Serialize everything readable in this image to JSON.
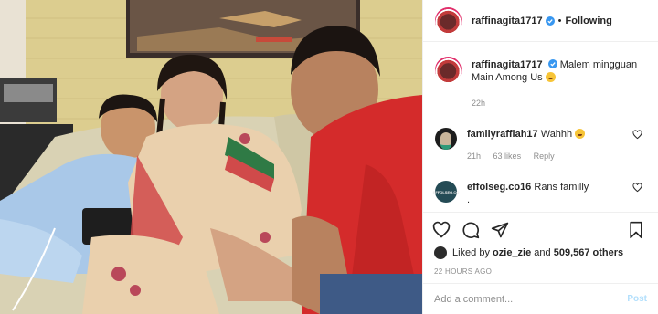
{
  "header": {
    "username": "raffinagita1717",
    "separator": "•",
    "follow_status": "Following"
  },
  "caption": {
    "username": "raffinagita1717",
    "text": "Malem mingguan Main Among Us",
    "time": "22h"
  },
  "comments": [
    {
      "username": "familyraffiah17",
      "text": "Wahhh",
      "time": "21h",
      "likes": "63 likes",
      "reply": "Reply"
    },
    {
      "username": "effolseg.co16",
      "text": "Rans familly",
      "extra": ".",
      "avatar_text": "EFFOLSEG.CO"
    }
  ],
  "actions": {
    "liked_by_prefix": "Liked by",
    "liked_by_user": "ozie_zie",
    "liked_by_and": "and",
    "liked_by_count": "509,567 others",
    "time_ago": "22 HOURS AGO"
  },
  "add_comment": {
    "placeholder": "Add a comment...",
    "post_label": "Post"
  },
  "colors": {
    "verified": "#3897f0",
    "post_button_disabled": "#b2dffc",
    "muted_text": "#8e8e8e"
  }
}
